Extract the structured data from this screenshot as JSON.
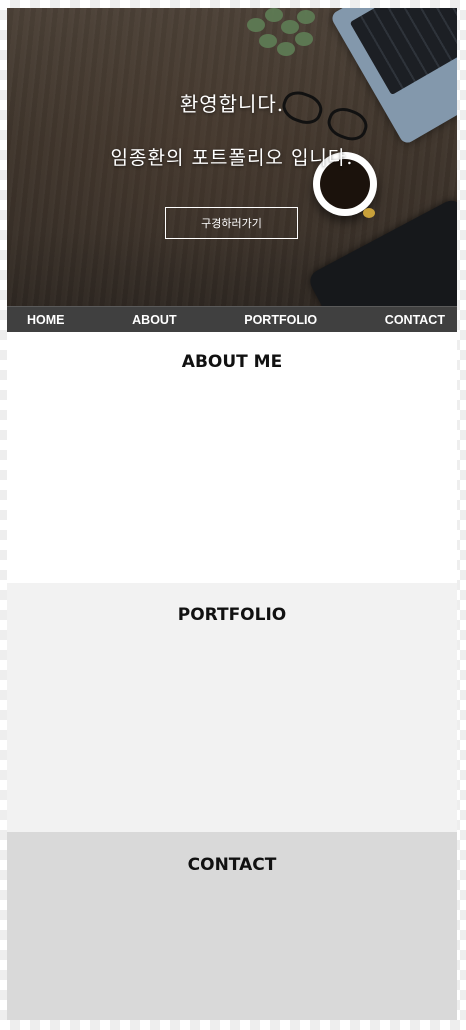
{
  "hero": {
    "greeting": "환영합니다.",
    "subtitle": "임종환의 포트폴리오 입니다.",
    "button_label": "구경하러가기"
  },
  "nav": {
    "items": [
      {
        "label": "HOME"
      },
      {
        "label": "ABOUT"
      },
      {
        "label": "PORTFOLIO"
      },
      {
        "label": "CONTACT"
      }
    ]
  },
  "sections": {
    "about_title": "ABOUT ME",
    "portfolio_title": "PORTFOLIO",
    "contact_title": "CONTACT"
  },
  "colors": {
    "nav_bg": "#404040",
    "about_bg": "#ffffff",
    "portfolio_bg": "#f2f2f2",
    "contact_bg": "#d9d9d9"
  }
}
